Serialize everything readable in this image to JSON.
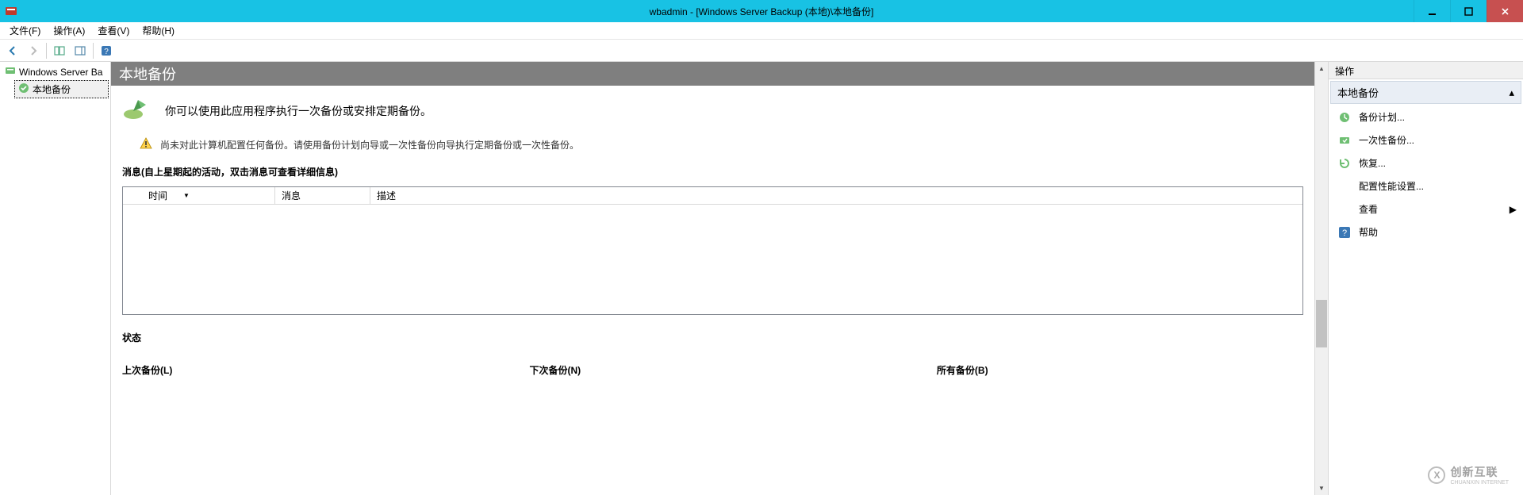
{
  "window": {
    "title": "wbadmin - [Windows Server Backup (本地)\\本地备份]"
  },
  "menubar": {
    "file": "文件(F)",
    "action": "操作(A)",
    "view": "查看(V)",
    "help": "帮助(H)"
  },
  "tree": {
    "root": "Windows Server Ba",
    "child": "本地备份"
  },
  "content": {
    "header": "本地备份",
    "intro": "你可以使用此应用程序执行一次备份或安排定期备份。",
    "warning": "尚未对此计算机配置任何备份。请使用备份计划向导或一次性备份向导执行定期备份或一次性备份。",
    "messages_label": "消息(自上星期起的活动，双击消息可查看详细信息)",
    "columns": {
      "time": "时间",
      "message": "消息",
      "desc": "描述"
    },
    "status_label": "状态",
    "last_backup": "上次备份(L)",
    "next_backup": "下次备份(N)",
    "all_backups": "所有备份(B)"
  },
  "actions": {
    "pane_title": "操作",
    "group": "本地备份",
    "items": {
      "schedule": "备份计划...",
      "once": "一次性备份...",
      "recover": "恢复...",
      "perf": "配置性能设置...",
      "view": "查看",
      "help": "帮助"
    }
  },
  "watermark": {
    "brand": "创新互联",
    "sub": "CHUANXIN INTERNET"
  }
}
